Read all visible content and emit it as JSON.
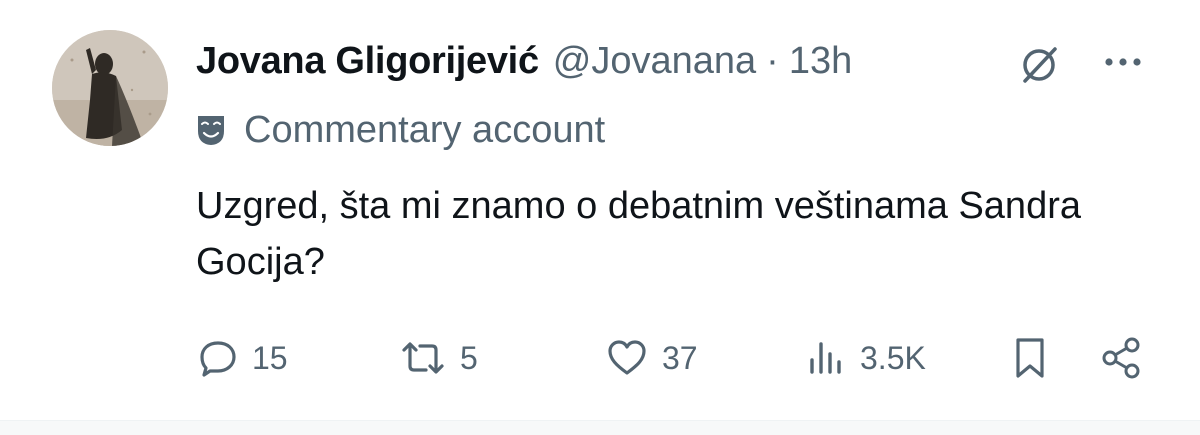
{
  "tweet": {
    "author": {
      "name": "Jovana Gligorijević",
      "handle": "@Jovanana"
    },
    "separator": "·",
    "time": "13h",
    "label": {
      "icon": "theater-masks-icon",
      "text": "Commentary account"
    },
    "text": "Uzgred, šta mi znamo o debatnim veštinama Sandra Gocija?",
    "actions": {
      "replies": "15",
      "reposts": "5",
      "likes": "37",
      "views": "3.5K"
    }
  },
  "colors": {
    "text_primary": "#0f1419",
    "text_secondary": "#536471",
    "background": "#ffffff"
  }
}
